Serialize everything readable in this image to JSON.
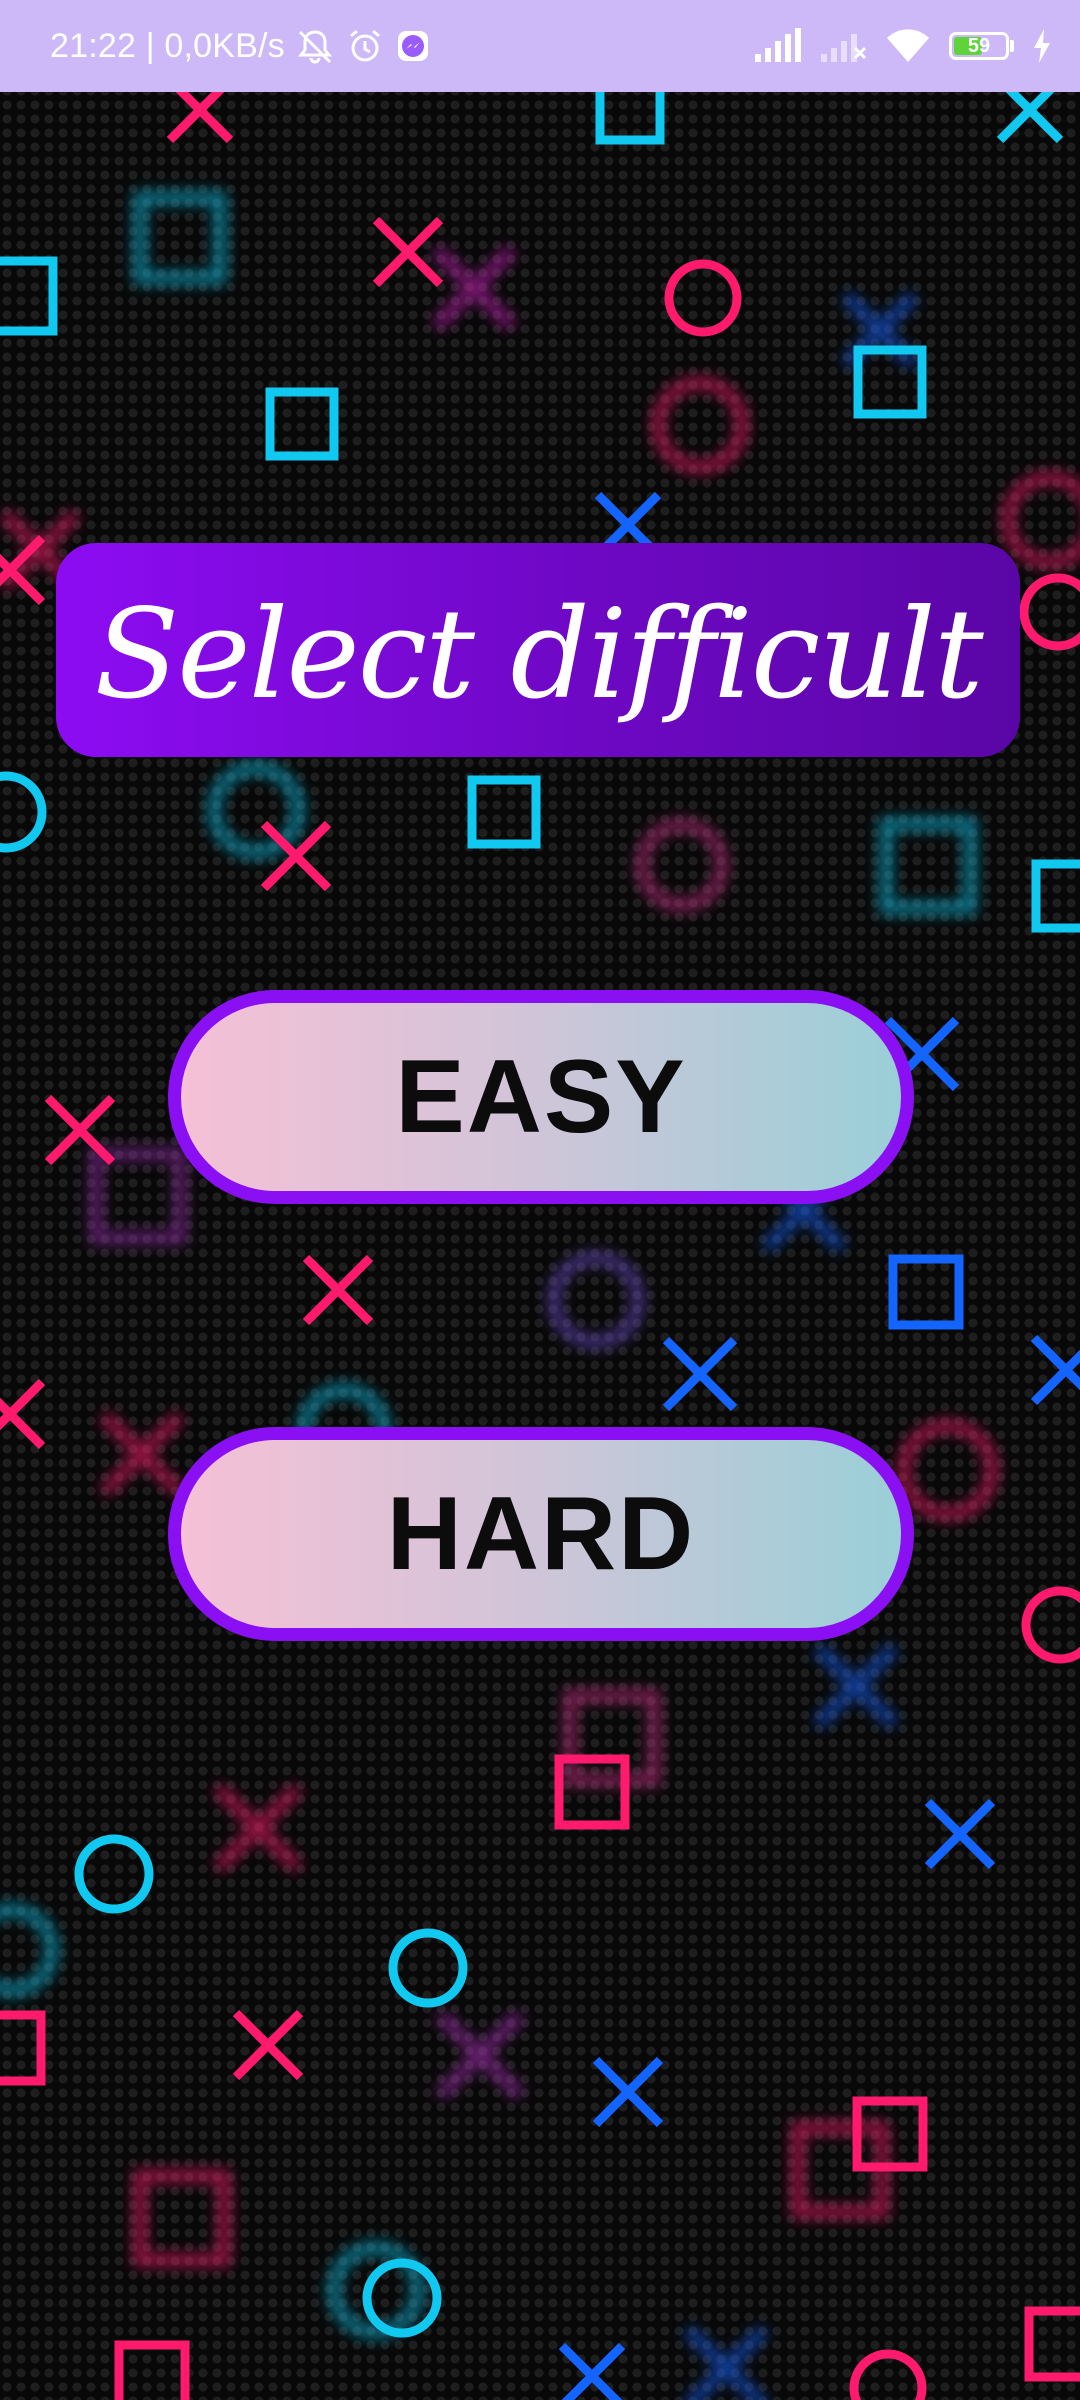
{
  "status_bar": {
    "time_speed": "21:22 | 0,0KB/s",
    "battery_level": "59",
    "battery_percent": 59,
    "icons": [
      "mute-icon",
      "alarm-icon",
      "messenger-icon",
      "signal-icon",
      "signal-no-service-icon",
      "wifi-icon",
      "battery-icon",
      "charging-icon"
    ]
  },
  "screen": {
    "title": "Select difficult",
    "buttons": {
      "easy_label": "EASY",
      "hard_label": "HARD"
    }
  },
  "colors": {
    "status_bar_bg": "#cdb9f7",
    "banner_purple": "#8d0cf3",
    "button_border": "#8a10f3",
    "shape_pink": "#ff1a6e",
    "shape_cyan": "#10c8f0",
    "shape_blue": "#1464ff"
  }
}
